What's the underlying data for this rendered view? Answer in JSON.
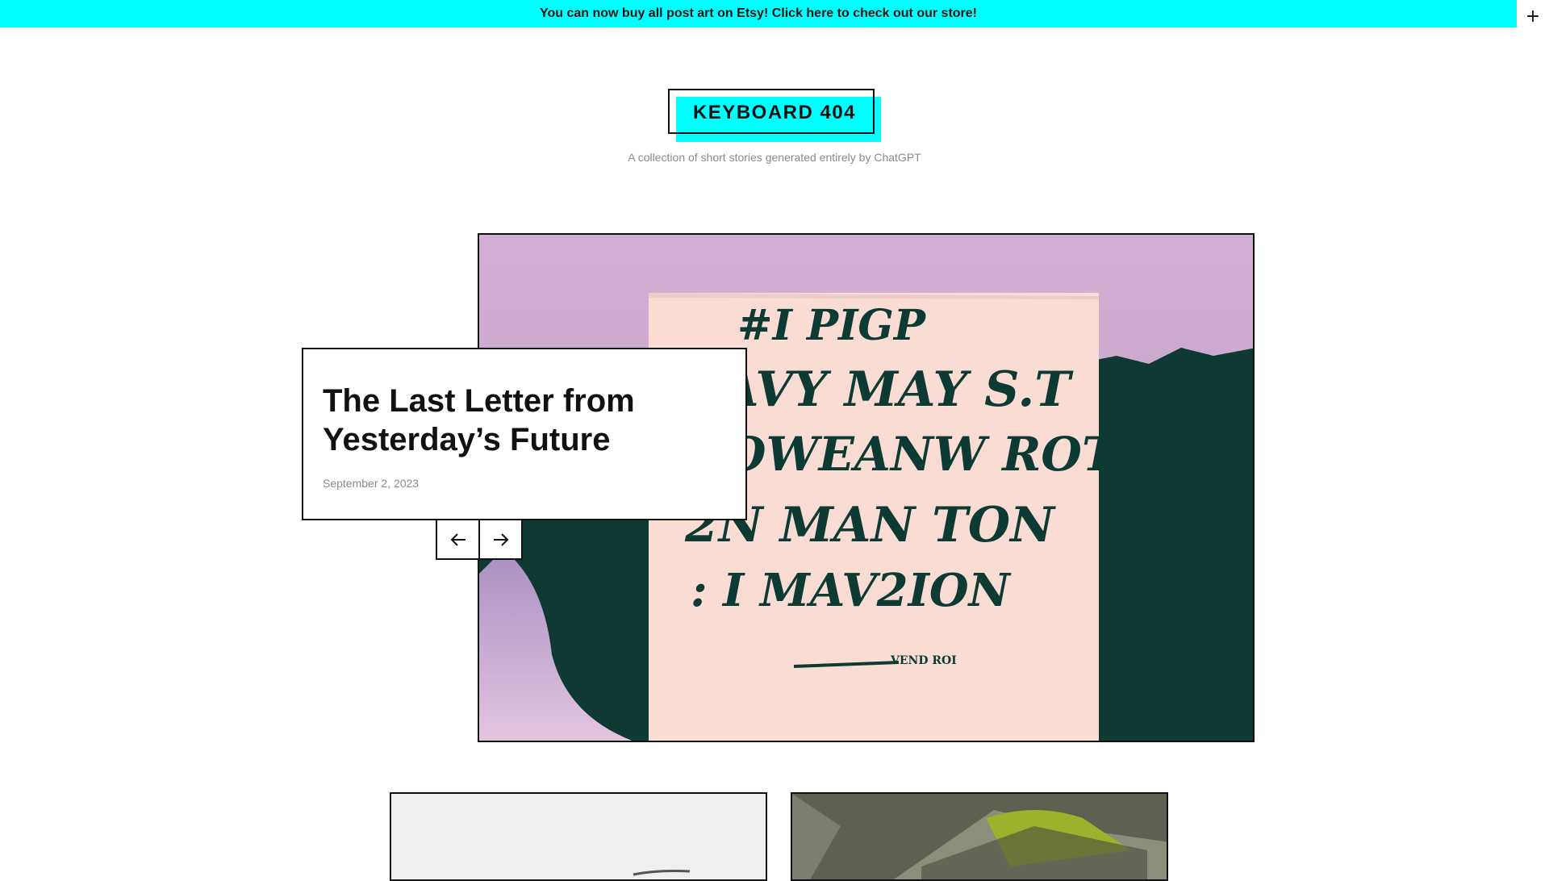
{
  "announcement": {
    "text": "You can now buy all post art on Etsy! Click here to check out our store!",
    "toggle": "+"
  },
  "site": {
    "logo": "KEYBOARD 404",
    "tagline": "A collection of short stories generated entirely by ChatGPT"
  },
  "featured_post": {
    "title": "The Last Letter from Yesterday’s Future",
    "date": "September 2, 2023"
  },
  "slider": {
    "prev_icon": "arrow-left-icon",
    "next_icon": "arrow-right-icon"
  },
  "colors": {
    "accent": "#00ffff",
    "text": "#111111",
    "muted": "#8a8a8a"
  }
}
